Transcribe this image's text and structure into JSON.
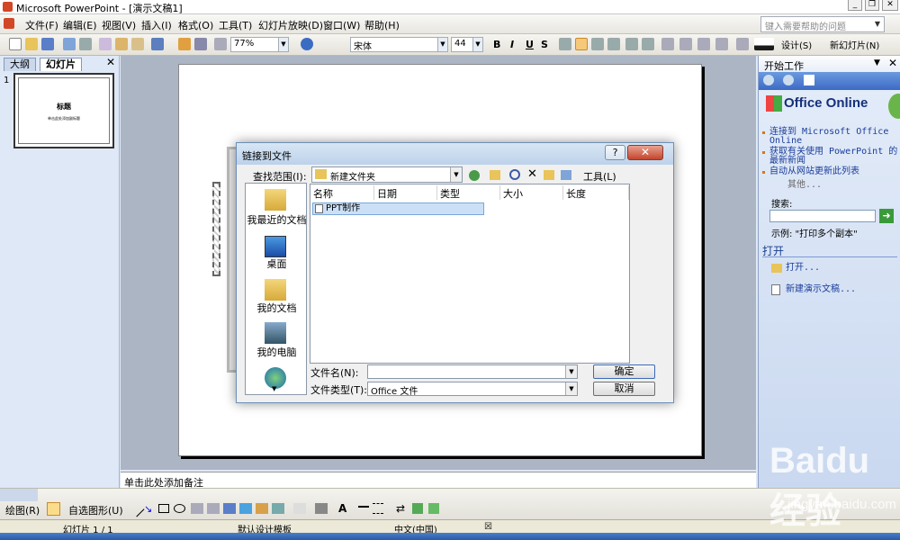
{
  "window": {
    "title": "Microsoft PowerPoint - [演示文稿1]"
  },
  "menu": [
    "文件(F)",
    "编辑(E)",
    "视图(V)",
    "插入(I)",
    "格式(O)",
    "工具(T)",
    "幻灯片放映(D)",
    "窗口(W)",
    "帮助(H)"
  ],
  "help_box": {
    "placeholder": "键入需要帮助的问题"
  },
  "toolbar": {
    "zoom": "77%",
    "font": "宋体",
    "font_size": "44",
    "bold": "B",
    "italic": "I",
    "underline": "U",
    "shadow": "S",
    "design_label": "设计(S)",
    "new_slide_label": "新幻灯片(N)"
  },
  "left_pane": {
    "tabs": [
      "大纲",
      "幻灯片"
    ],
    "slide_number": "1",
    "thumb_title": "标题",
    "thumb_subtitle": "单击此处添加副标题"
  },
  "notes": {
    "placeholder": "单击此处添加备注"
  },
  "task_pane": {
    "title": "开始工作",
    "office_online": "Office Online",
    "links": [
      "连接到 Microsoft Office Online",
      "获取有关使用 PowerPoint 的最新新闻",
      "自动从网站更新此列表"
    ],
    "more": "其他...",
    "search_label": "搜索:",
    "example": "示例: \"打印多个副本\"",
    "open_section": "打开",
    "open_link": "打开...",
    "new_presentation": "新建演示文稿..."
  },
  "dialog": {
    "title": "链接到文件",
    "look_in_label": "查找范围(I):",
    "look_in_value": "新建文件夹",
    "tools_label": "工具(L)",
    "places": [
      "我最近的文档",
      "桌面",
      "我的文档",
      "我的电脑"
    ],
    "columns": [
      "名称",
      "日期",
      "类型",
      "大小",
      "长度"
    ],
    "files": [
      "PPT制作"
    ],
    "filename_label": "文件名(N):",
    "filename_value": "",
    "filetype_label": "文件类型(T):",
    "filetype_value": "Office 文件",
    "ok_label": "确定",
    "cancel_label": "取消"
  },
  "drawing_toolbar": {
    "draw_label": "绘图(R)",
    "autoshapes_label": "自选图形(U)"
  },
  "status_bar": {
    "slide_info": "幻灯片 1 / 1",
    "template": "默认设计模板",
    "language": "中文(中国)"
  },
  "watermark": {
    "brand": "Baidu经验",
    "url": "jingyan.baidu.com"
  },
  "colors": {
    "accent": "#316ac5",
    "task_pane_link": "#1a3c9a",
    "office_red": "#d24726"
  }
}
